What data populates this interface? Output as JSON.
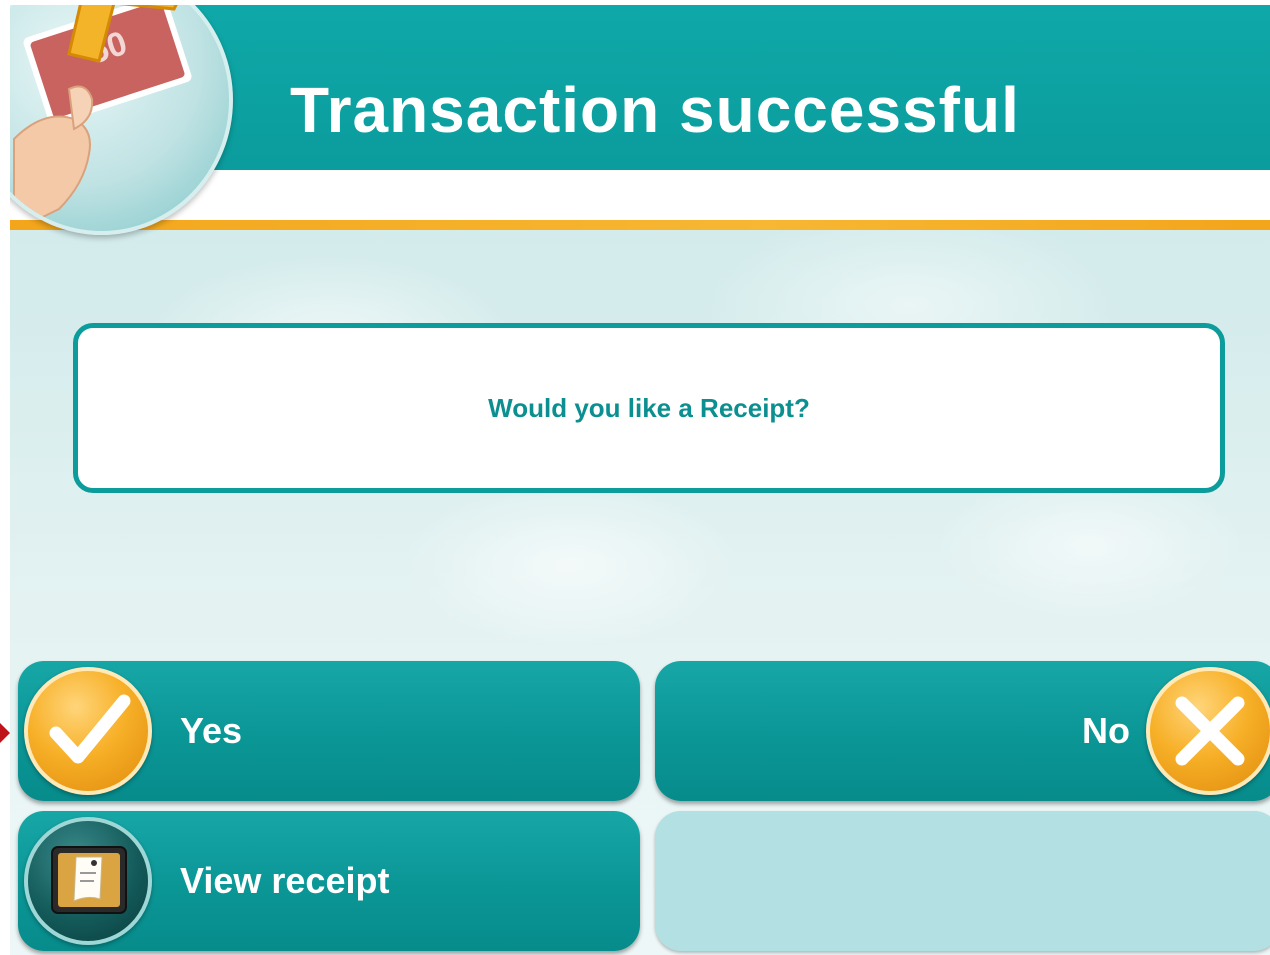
{
  "header": {
    "title": "Transaction successful",
    "logo_icon": "hand-holding-banknote-icon"
  },
  "prompt": {
    "text": "Would you like a Receipt?"
  },
  "buttons": {
    "yes": {
      "label": "Yes",
      "icon": "check-icon"
    },
    "no": {
      "label": "No",
      "icon": "x-icon"
    },
    "view_receipt": {
      "label": "View receipt",
      "icon": "receipt-icon"
    }
  },
  "colors": {
    "teal": "#0b9c9d",
    "orange_accent": "#f3a51b",
    "empty_button": "#b3e0e2",
    "selection_marker": "#c0141b"
  }
}
